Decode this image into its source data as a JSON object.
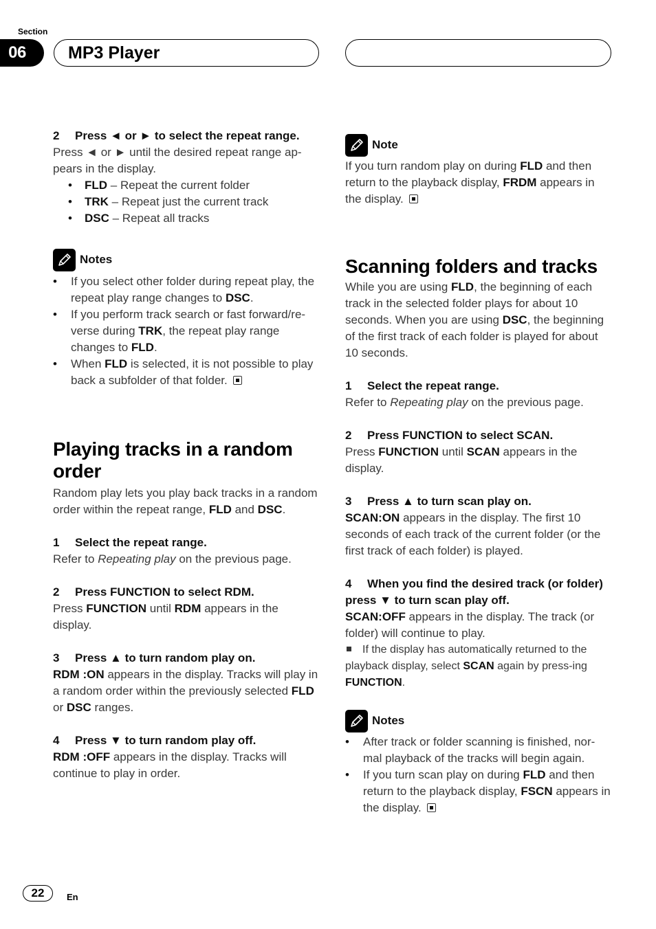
{
  "header": {
    "section_label": "Section",
    "section_number": "06",
    "title": "MP3 Player"
  },
  "icons": {
    "note": "pencil-note-icon",
    "end_mark": "end-square-icon",
    "bullet": "bullet-dot",
    "square_bullet": "square-bullet-icon"
  },
  "left": {
    "step2": {
      "num": "2",
      "heading": "Press ◄ or ► to select the repeat range.",
      "body": [
        {
          "t": "Press ◄ or ► until the desired repeat range ap-pears in the display."
        }
      ],
      "options": [
        [
          {
            "t": "FLD",
            "b": true
          },
          {
            "t": " – Repeat the current folder"
          }
        ],
        [
          {
            "t": "TRK",
            "b": true
          },
          {
            "t": " – Repeat just the current track"
          }
        ],
        [
          {
            "t": "DSC",
            "b": true
          },
          {
            "t": " – Repeat all tracks"
          }
        ]
      ]
    },
    "notes1": {
      "title": "Notes",
      "items": [
        [
          {
            "t": "If you select other folder during repeat play, the repeat play range changes to "
          },
          {
            "t": "DSC",
            "b": true
          },
          {
            "t": "."
          }
        ],
        [
          {
            "t": "If you perform track search or fast forward/re-verse during "
          },
          {
            "t": "TRK",
            "b": true
          },
          {
            "t": ", the repeat play range changes to "
          },
          {
            "t": "FLD",
            "b": true
          },
          {
            "t": "."
          }
        ],
        [
          {
            "t": "When "
          },
          {
            "t": "FLD",
            "b": true
          },
          {
            "t": " is selected, it is not possible to play back a subfolder of that folder. "
          },
          {
            "end": true
          }
        ]
      ]
    },
    "random": {
      "title": "Playing tracks in a random order",
      "intro": [
        {
          "t": "Random play lets you play back tracks in a random order within the repeat range, "
        },
        {
          "t": "FLD",
          "b": true
        },
        {
          "t": " and "
        },
        {
          "t": "DSC",
          "b": true
        },
        {
          "t": "."
        }
      ],
      "steps": [
        {
          "num": "1",
          "heading": "Select the repeat range.",
          "body": [
            {
              "t": "Refer to "
            },
            {
              "t": "Repeating play",
              "i": true
            },
            {
              "t": " on the previous page."
            }
          ]
        },
        {
          "num": "2",
          "heading": "Press FUNCTION to select RDM.",
          "body": [
            {
              "t": "Press "
            },
            {
              "t": "FUNCTION",
              "b": true
            },
            {
              "t": " until "
            },
            {
              "t": "RDM",
              "b": true
            },
            {
              "t": " appears in the display."
            }
          ]
        },
        {
          "num": "3",
          "heading": "Press ▲ to turn random play on.",
          "body": [
            {
              "t": "RDM :ON",
              "b": true
            },
            {
              "t": " appears in the display. Tracks will play in a random order within the previously selected "
            },
            {
              "t": "FLD",
              "b": true
            },
            {
              "t": " or "
            },
            {
              "t": "DSC",
              "b": true
            },
            {
              "t": " ranges."
            }
          ]
        },
        {
          "num": "4",
          "heading": "Press ▼ to turn random play off.",
          "body": [
            {
              "t": "RDM :OFF",
              "b": true
            },
            {
              "t": " appears in the display. Tracks will continue to play in order."
            }
          ]
        }
      ]
    }
  },
  "right": {
    "note1": {
      "title": "Note",
      "body": [
        {
          "t": "If you turn random play on during "
        },
        {
          "t": "FLD",
          "b": true
        },
        {
          "t": " and then return to the playback display, "
        },
        {
          "t": "FRDM",
          "b": true
        },
        {
          "t": " appears in the display. "
        },
        {
          "end": true
        }
      ]
    },
    "scan": {
      "title": "Scanning folders and tracks",
      "intro": [
        {
          "t": "While you are using "
        },
        {
          "t": "FLD",
          "b": true
        },
        {
          "t": ", the beginning of each track in the selected folder plays for about 10 seconds. When you are using "
        },
        {
          "t": "DSC",
          "b": true
        },
        {
          "t": ", the beginning of the first track of each folder is played for about 10 seconds."
        }
      ],
      "steps": [
        {
          "num": "1",
          "heading": "Select the repeat range.",
          "body": [
            {
              "t": "Refer to "
            },
            {
              "t": "Repeating play",
              "i": true
            },
            {
              "t": " on the previous page."
            }
          ]
        },
        {
          "num": "2",
          "heading": "Press FUNCTION to select SCAN.",
          "body": [
            {
              "t": "Press "
            },
            {
              "t": "FUNCTION",
              "b": true
            },
            {
              "t": " until "
            },
            {
              "t": "SCAN",
              "b": true
            },
            {
              "t": " appears in the display."
            }
          ]
        },
        {
          "num": "3",
          "heading": "Press ▲ to turn scan play on.",
          "body": [
            {
              "t": "SCAN:ON",
              "b": true
            },
            {
              "t": " appears in the display. The first 10 seconds of each track of the current folder (or the first track of each folder) is played."
            }
          ]
        },
        {
          "num": "4",
          "heading": "When you find the desired track (or folder) press ▼ to turn scan play off.",
          "body": [
            {
              "t": "SCAN:OFF",
              "b": true
            },
            {
              "t": " appears in the display. The track (or folder) will continue to play."
            }
          ],
          "tip": [
            {
              "sq": true
            },
            {
              "t": "If the display has automatically returned to the playback display, select "
            },
            {
              "t": "SCAN",
              "b": true
            },
            {
              "t": " again by press-ing "
            },
            {
              "t": "FUNCTION",
              "b": true
            },
            {
              "t": "."
            }
          ]
        }
      ]
    },
    "notes2": {
      "title": "Notes",
      "items": [
        [
          {
            "t": "After track or folder scanning is finished, nor-mal playback of the tracks will begin again."
          }
        ],
        [
          {
            "t": "If you turn scan play on during "
          },
          {
            "t": "FLD",
            "b": true
          },
          {
            "t": " and then return to the playback display, "
          },
          {
            "t": "FSCN",
            "b": true
          },
          {
            "t": " appears in the display. "
          },
          {
            "end": true
          }
        ]
      ]
    }
  },
  "footer": {
    "page_number": "22",
    "language": "En"
  }
}
